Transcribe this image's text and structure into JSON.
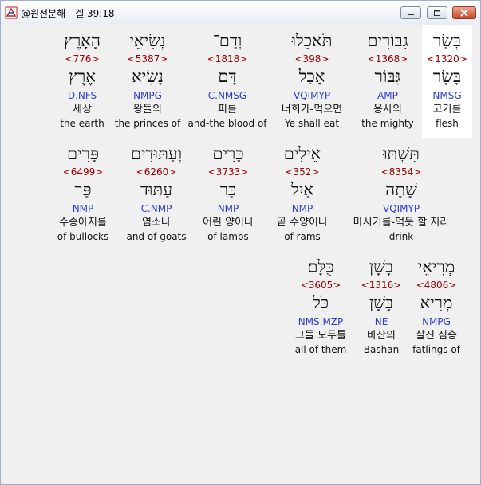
{
  "window": {
    "title": "@원전분해 - 겔 39:18",
    "controls": {
      "minimize": "minimize-icon",
      "maximize": "maximize-icon",
      "close": "close-icon"
    }
  },
  "colors": {
    "strong_number": "#a00000",
    "grammar": "#2a3bd2",
    "text": "#111111",
    "highlight_bg": "#ffffff"
  },
  "rows": [
    {
      "words": [
        {
          "hebrew": "בְּשַׂר",
          "strong": "<1320>",
          "lemma": "בָּשָׂר",
          "grammar": "NMSG",
          "korean": "고기를",
          "english": "flesh",
          "highlighted": true
        },
        {
          "hebrew": "גִּבּוֹרִים",
          "strong": "<1368>",
          "lemma": "גִּבּוֹר",
          "grammar": "AMP",
          "korean": "용사의",
          "english": "the mighty",
          "highlighted": false
        },
        {
          "hebrew": "תֹּאכֵלוּ",
          "strong": "<398>",
          "lemma": "אָכַל",
          "grammar": "VQIMYP",
          "korean": "너희가-먹으면",
          "english": "Ye shall eat",
          "highlighted": false
        },
        {
          "hebrew": "וְדַם־",
          "strong": "<1818>",
          "lemma": "דָּם",
          "grammar": "C.NMSG",
          "korean": "피를",
          "english": "and-the blood of",
          "highlighted": false
        },
        {
          "hebrew": "נְשִׂיאֵי",
          "strong": "<5387>",
          "lemma": "נָשִׂיא",
          "grammar": "NMPG",
          "korean": "왕들의",
          "english": "the princes of",
          "highlighted": false
        },
        {
          "hebrew": "הָאָרֶץ",
          "strong": "<776>",
          "lemma": "אֶרֶץ",
          "grammar": "D.NFS",
          "korean": "세상",
          "english": "the earth",
          "highlighted": false
        }
      ]
    },
    {
      "words": [
        {
          "hebrew": "תִּשְׁתּוּ",
          "strong": "<8354>",
          "lemma": "שָׁתָה",
          "grammar": "VQIMYP",
          "korean": "마시기를-먹듯 할 지라",
          "english": "drink",
          "highlighted": false
        },
        {
          "hebrew": "אֵילִים",
          "strong": "<352>",
          "lemma": "אַיִל",
          "grammar": "NMP",
          "korean": "곧 수양이나",
          "english": "of rams",
          "highlighted": false
        },
        {
          "hebrew": "כָּרִים",
          "strong": "<3733>",
          "lemma": "כַּר",
          "grammar": "NMP",
          "korean": "어린 양이나",
          "english": "of lambs",
          "highlighted": false
        },
        {
          "hebrew": "וְעַתּוּדִים",
          "strong": "<6260>",
          "lemma": "עַתּוּד",
          "grammar": "C.NMP",
          "korean": "염소나",
          "english": "and of goats",
          "highlighted": false
        },
        {
          "hebrew": "פָּרִים",
          "strong": "<6499>",
          "lemma": "פַּר",
          "grammar": "NMP",
          "korean": "수송아지를",
          "english": "of bullocks",
          "highlighted": false
        }
      ]
    },
    {
      "words": [
        {
          "hebrew": "מְרִיאֵי",
          "strong": "<4806>",
          "lemma": "מְרִיא",
          "grammar": "NMPG",
          "korean": "살진 짐승",
          "english": "fatlings of",
          "highlighted": false
        },
        {
          "hebrew": "בָשָׁן",
          "strong": "<1316>",
          "lemma": "בָּשָׁן",
          "grammar": "NE",
          "korean": "바산의",
          "english": "Bashan",
          "highlighted": false
        },
        {
          "hebrew": "כֻּלָּם׃",
          "strong": "<3605>",
          "lemma": "כֹּל",
          "grammar": "NMS.MZP",
          "korean": "그들 모두를",
          "english": "all of them",
          "highlighted": false
        }
      ]
    }
  ]
}
